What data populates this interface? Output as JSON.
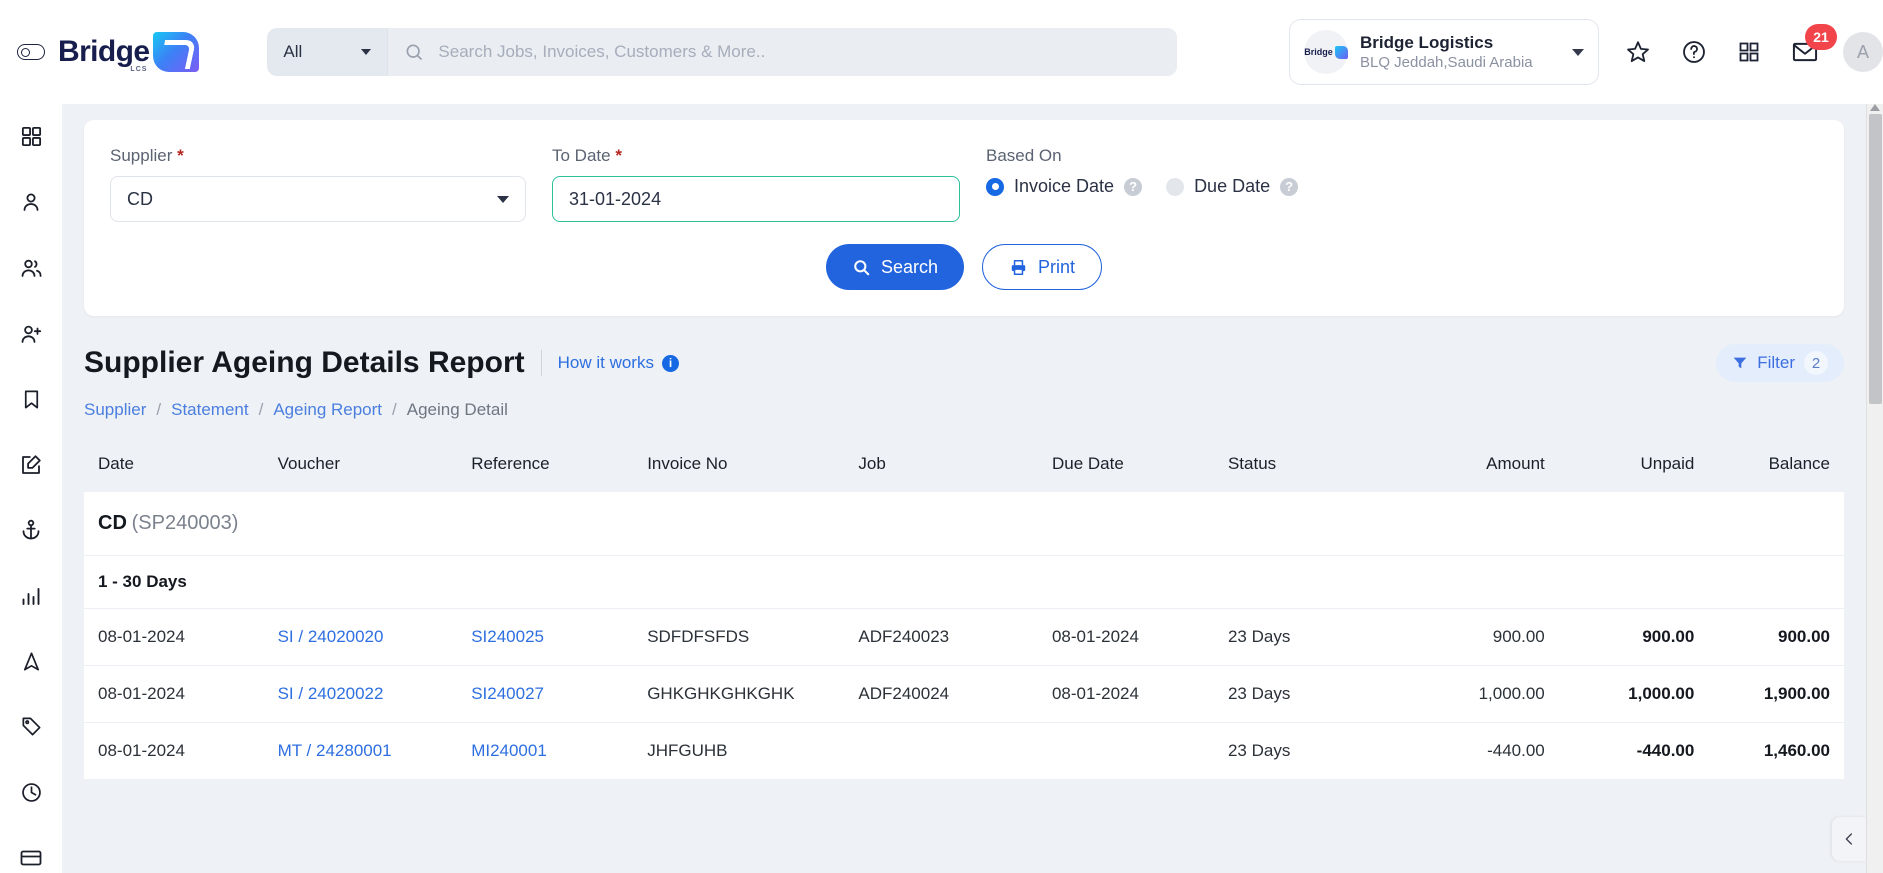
{
  "header": {
    "menu_toggle_icon": "menu-toggle-icon",
    "brand_name": "Bridge",
    "brand_sub": "LCS",
    "search": {
      "scope_value": "All",
      "placeholder": "Search Jobs, Invoices, Customers & More..",
      "value": ""
    },
    "org": {
      "name": "Bridge Logistics",
      "location": "BLQ Jeddah,Saudi Arabia",
      "avatar_text": "Bridge"
    },
    "icons": [
      "star-icon",
      "help-icon",
      "apps-grid-icon",
      "mail-icon"
    ],
    "mail_badge": "21",
    "user_initial": "A"
  },
  "sidebar": {
    "items": [
      {
        "icon": "dashboard-grid-icon",
        "label": "Dashboard"
      },
      {
        "icon": "person-icon",
        "label": "Customer"
      },
      {
        "icon": "people-icon",
        "label": "Contacts"
      },
      {
        "icon": "person-add-icon",
        "label": "Add User"
      },
      {
        "icon": "bookmark-icon",
        "label": "Bookmarks"
      },
      {
        "icon": "edit-document-icon",
        "label": "Jobs"
      },
      {
        "icon": "anchor-icon",
        "label": "Shipping"
      },
      {
        "icon": "bar-chart-icon",
        "label": "Reports"
      },
      {
        "icon": "navigation-icon",
        "label": "Air Freight"
      },
      {
        "icon": "tag-icon",
        "label": "Tariff"
      },
      {
        "icon": "clock-icon",
        "label": "History"
      },
      {
        "icon": "credit-card-icon",
        "label": "Accounts"
      }
    ]
  },
  "filter_form": {
    "supplier": {
      "label": "Supplier",
      "required": "*",
      "value": "CD"
    },
    "to_date": {
      "label": "To Date",
      "required": "*",
      "value": "31-01-2024"
    },
    "based_on": {
      "label": "Based On",
      "options": [
        {
          "label": "Invoice Date",
          "selected": true
        },
        {
          "label": "Due Date",
          "selected": false
        }
      ],
      "help_glyph": "?"
    },
    "search_button": "Search",
    "print_button": "Print"
  },
  "page": {
    "title": "Supplier Ageing Details Report",
    "how_it_works": "How it works",
    "info_glyph": "i",
    "filter_button": {
      "label": "Filter",
      "count": "2",
      "icon": "funnel-icon"
    },
    "breadcrumb": [
      {
        "label": "Supplier",
        "link": true
      },
      {
        "label": "Statement",
        "link": true
      },
      {
        "label": "Ageing Report",
        "link": true
      },
      {
        "label": "Ageing Detail",
        "link": false
      }
    ],
    "breadcrumb_sep": "/"
  },
  "table": {
    "columns": [
      "Date",
      "Voucher",
      "Reference",
      "Invoice No",
      "Job",
      "Due Date",
      "Status",
      "Amount",
      "Unpaid",
      "Balance"
    ],
    "group": {
      "name": "CD",
      "code": "(SP240003)"
    },
    "bucket": "1 - 30 Days",
    "rows": [
      {
        "date": "08-01-2024",
        "voucher": "SI / 24020020",
        "reference": "SI240025",
        "invoice_no": "SDFDFSFDS",
        "job": "ADF240023",
        "due_date": "08-01-2024",
        "status": "23 Days",
        "amount": "900.00",
        "unpaid": "900.00",
        "balance": "900.00"
      },
      {
        "date": "08-01-2024",
        "voucher": "SI / 24020022",
        "reference": "SI240027",
        "invoice_no": "GHKGHKGHKGHK",
        "job": "ADF240024",
        "due_date": "08-01-2024",
        "status": "23 Days",
        "amount": "1,000.00",
        "unpaid": "1,000.00",
        "balance": "1,900.00"
      },
      {
        "date": "08-01-2024",
        "voucher": "MT / 24280001",
        "reference": "MI240001",
        "invoice_no": "JHFGUHB",
        "job": "",
        "due_date": "",
        "status": "23 Days",
        "amount": "-440.00",
        "unpaid": "-440.00",
        "balance": "1,460.00"
      }
    ]
  },
  "colors": {
    "primary": "#2264dd",
    "link": "#2d6fe0",
    "badge_red": "#f2454b",
    "focus_green": "#2bbf9a",
    "brand_navy": "#171d4d"
  }
}
